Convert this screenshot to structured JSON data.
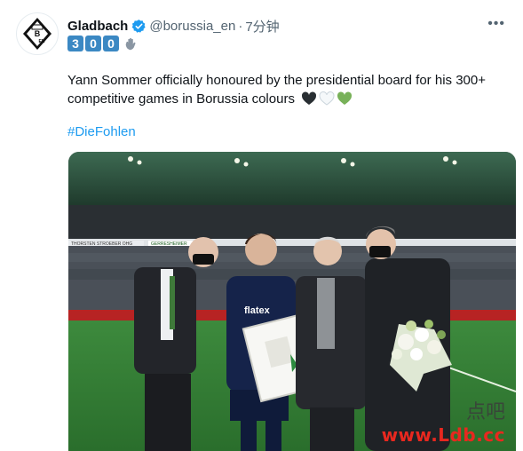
{
  "tweet": {
    "author_name": "Gladbach",
    "handle": "@borussia_en",
    "separator": "·",
    "time": "7分钟",
    "more_label": "•••",
    "number_keycaps": [
      "3",
      "0",
      "0"
    ],
    "text": "Yann Sommer officially honoured by the presidential board for his 300+ competitive games in Borussia colours",
    "hashtag": "#DieFohlen"
  },
  "photo": {
    "sponsor_text": "flatex",
    "board_labels": [
      "THORSTEN STROEBER OHG",
      "GERRESHEIMER"
    ]
  },
  "watermark": {
    "line1": "点吧",
    "line2": "www.Ldb.cc"
  },
  "colors": {
    "verified_blue": "#1d9bf0",
    "keycap_blue": "#3b88c3",
    "hashtag_blue": "#1d9bf0",
    "heart_black": "#292f33",
    "heart_white": "#e1e8ed",
    "heart_green": "#78b159",
    "watermark_red": "#e8281f"
  },
  "icons": [
    "borussia-logo-icon",
    "verified-badge-icon",
    "keycap-3-icon",
    "keycap-0-icon",
    "waving-hand-icon",
    "black-heart-icon",
    "white-heart-icon",
    "green-heart-icon",
    "more-options-icon"
  ]
}
